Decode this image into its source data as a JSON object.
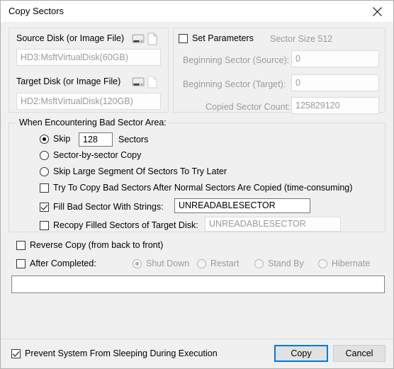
{
  "window": {
    "title": "Copy Sectors",
    "close_label": "✕"
  },
  "source_group": {
    "source_label": "Source Disk (or Image File)",
    "source_value": "HD3:MsftVirtualDisk(60GB)",
    "target_label": "Target Disk (or Image File)",
    "target_value": "HD2:MsftVirtualDisk(120GB)",
    "disk_icon_name": "hard-disk-icon",
    "file_icon_name": "file-icon"
  },
  "parameters_group": {
    "set_parameters_label": "Set Parameters",
    "set_parameters_checked": false,
    "sector_size_label": "Sector Size 512",
    "beginning_source_label": "Beginning Sector (Source):",
    "beginning_source_value": "0",
    "beginning_target_label": "Beginning Sector (Target):",
    "beginning_target_value": "0",
    "copied_count_label": "Copied Sector Count:",
    "copied_count_value": "125829120"
  },
  "bad_sector_group": {
    "legend": "When Encountering Bad Sector Area:",
    "skip_label": "Skip",
    "skip_value": "128",
    "sectors_label": "Sectors",
    "sector_by_sector_label": "Sector-by-sector Copy",
    "skip_large_label": "Skip Large Segment Of Sectors To Try Later",
    "selected_mode": "skip",
    "try_copy_label": "Try To Copy Bad Sectors After Normal Sectors Are Copied (time-consuming)",
    "try_copy_checked": false,
    "fill_label": "Fill Bad Sector With Strings:",
    "fill_checked": true,
    "fill_value": "UNREADABLESECTOR",
    "recopy_label": "Recopy Filled Sectors of Target Disk:",
    "recopy_checked": false,
    "recopy_value": "UNREADABLESECTOR"
  },
  "options": {
    "reverse_copy_label": "Reverse Copy (from back to front)",
    "reverse_copy_checked": false,
    "after_completed_label": "After Completed:",
    "after_completed_checked": false,
    "after_options": [
      {
        "label": "Shut Down",
        "selected": true
      },
      {
        "label": "Restart",
        "selected": false
      },
      {
        "label": "Stand By",
        "selected": false
      },
      {
        "label": "Hibernate",
        "selected": false
      }
    ]
  },
  "status": {
    "log_text": ""
  },
  "footer": {
    "prevent_sleep_label": "Prevent System From Sleeping During Execution",
    "prevent_sleep_checked": true,
    "copy_label": "Copy",
    "cancel_label": "Cancel"
  },
  "colors": {
    "accent": "#0078d7",
    "dialog_bg": "#f0f0f0",
    "titlebar_bg": "#ffffff",
    "disabled_text": "#9b9b9b",
    "group_border": "#dcdcdc"
  }
}
